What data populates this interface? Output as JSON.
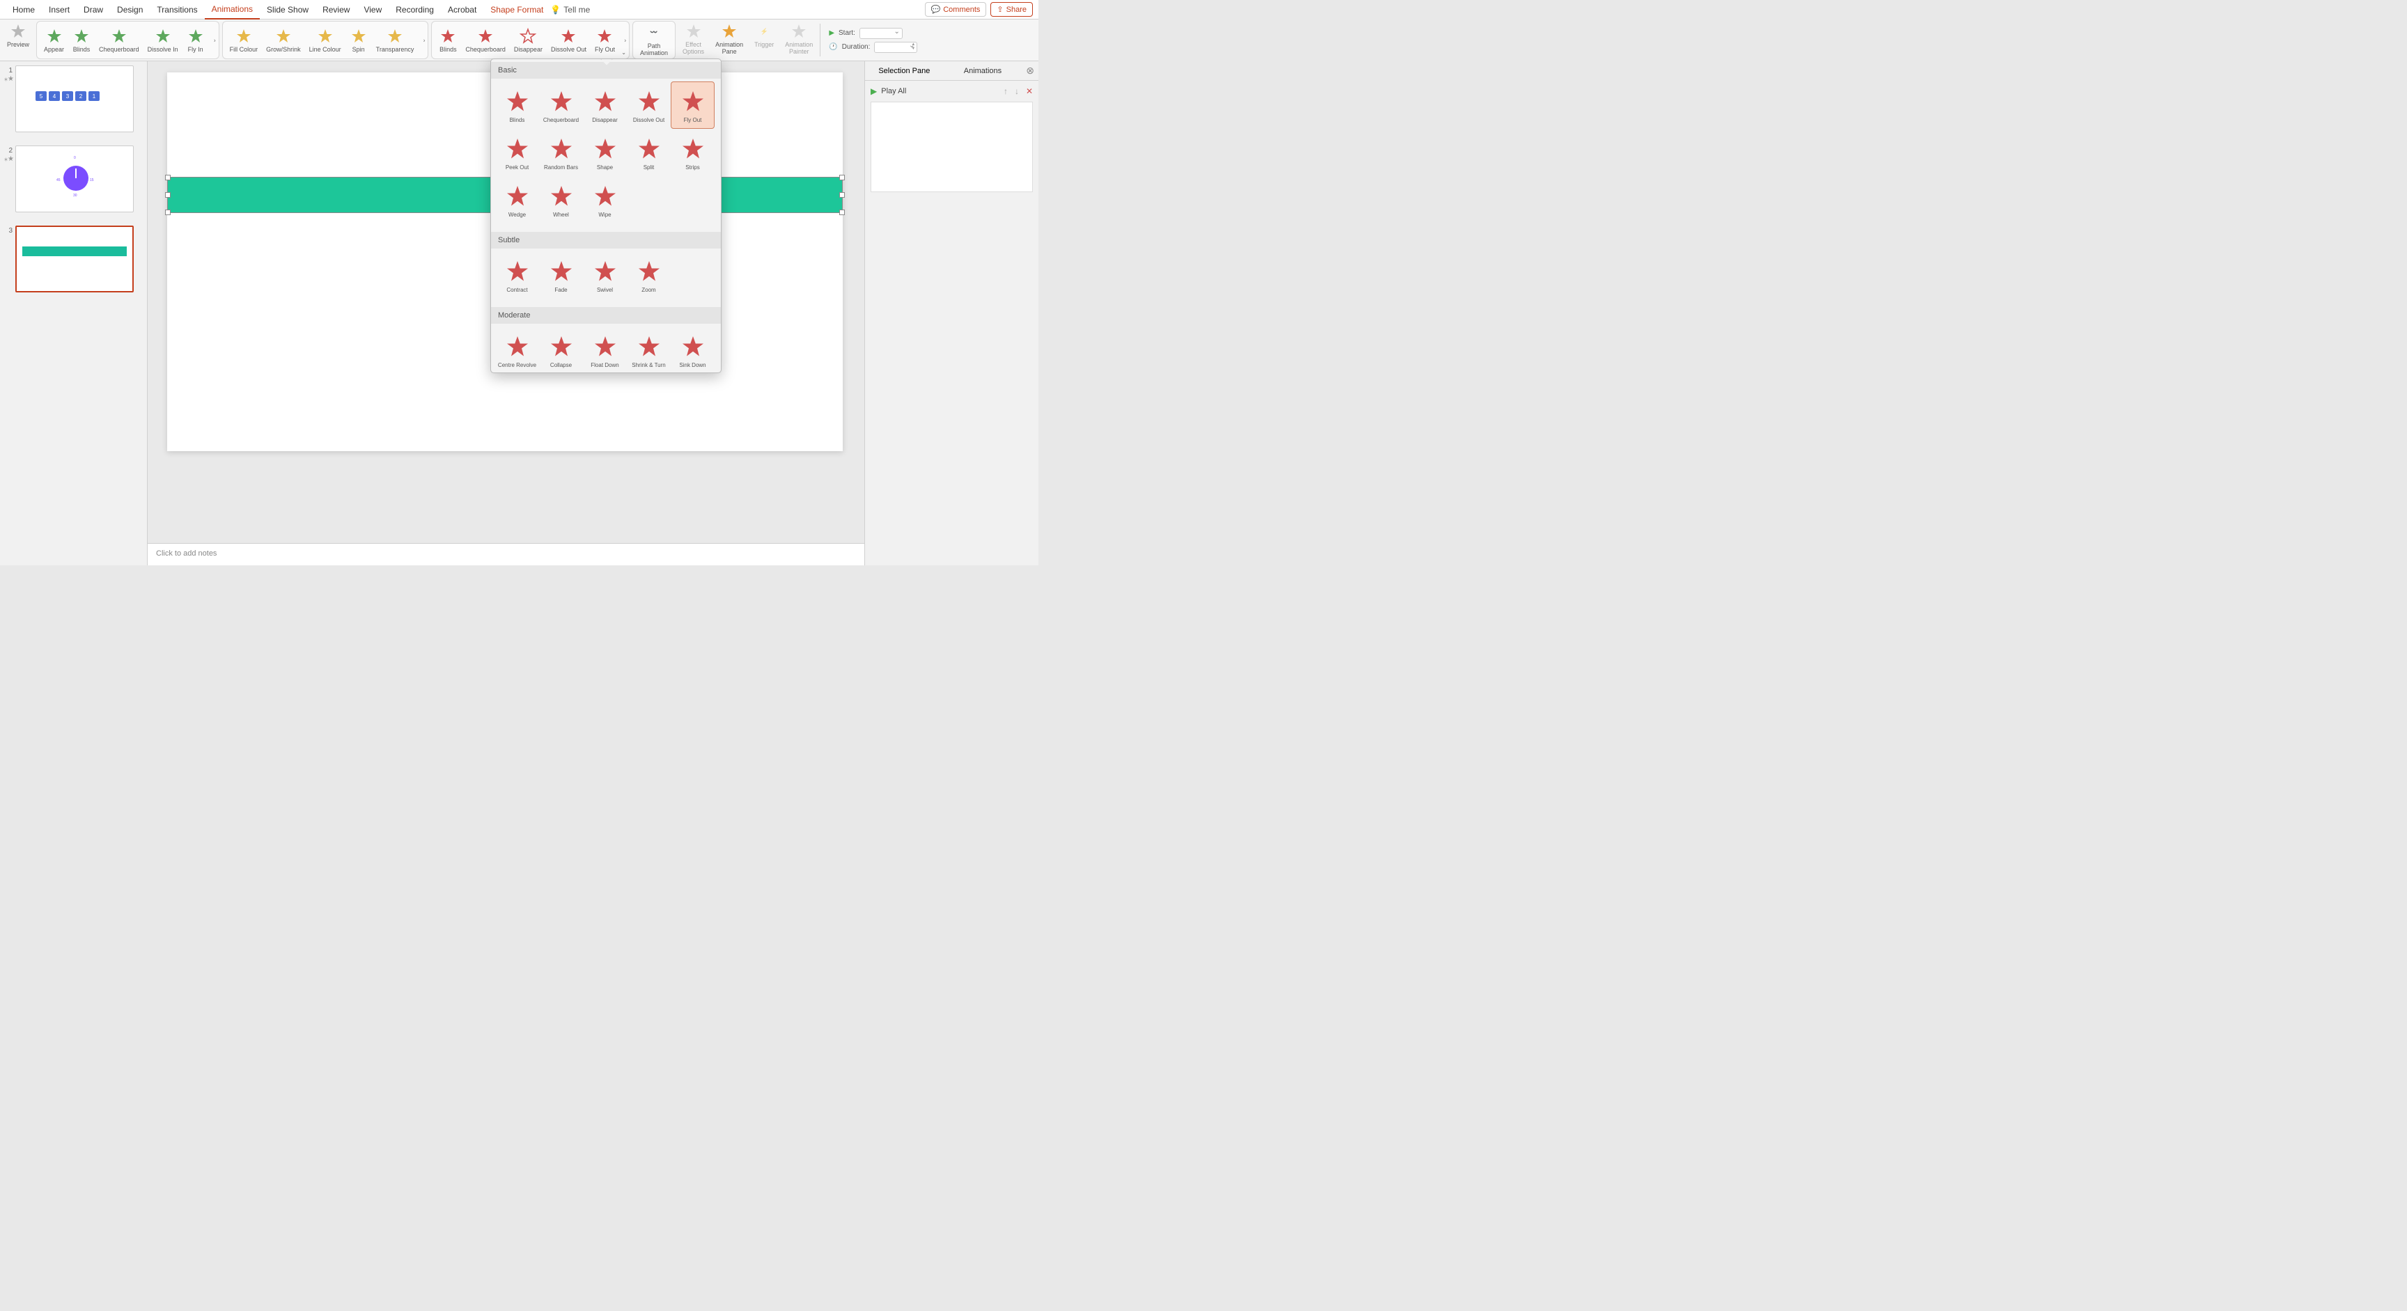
{
  "tabs": [
    "Home",
    "Insert",
    "Draw",
    "Design",
    "Transitions",
    "Animations",
    "Slide Show",
    "Review",
    "View",
    "Recording",
    "Acrobat",
    "Shape Format"
  ],
  "active_tab": "Animations",
  "context_tab": "Shape Format",
  "tellme": "Tell me",
  "comments": "Comments",
  "share": "Share",
  "ribbon": {
    "preview": "Preview",
    "entrance": [
      "Appear",
      "Blinds",
      "Chequerboard",
      "Dissolve In",
      "Fly In"
    ],
    "emphasis": [
      "Fill Colour",
      "Grow/Shrink",
      "Line Colour",
      "Spin",
      "Transparency"
    ],
    "exit": [
      "Blinds",
      "Chequerboard",
      "Disappear",
      "Dissolve Out",
      "Fly Out"
    ],
    "path_animation": "Path\nAnimation",
    "effect_options": "Effect\nOptions",
    "animation_pane": "Animation\nPane",
    "trigger": "Trigger",
    "animation_painter": "Animation\nPainter",
    "start_label": "Start:",
    "duration_label": "Duration:"
  },
  "slides": [
    {
      "num": "1",
      "boxes": [
        "5",
        "4",
        "3",
        "2",
        "1"
      ]
    },
    {
      "num": "2"
    },
    {
      "num": "3"
    }
  ],
  "notes_placeholder": "Click to add notes",
  "right_panel": {
    "tab1": "Selection Pane",
    "tab2": "Animations",
    "play_all": "Play All"
  },
  "gallery": {
    "sections": [
      {
        "header": "Basic",
        "items": [
          "Blinds",
          "Chequerboard",
          "Disappear",
          "Dissolve Out",
          "Fly Out",
          "Peek Out",
          "Random Bars",
          "Shape",
          "Split",
          "Strips",
          "Wedge",
          "Wheel",
          "Wipe"
        ],
        "selected": "Fly Out"
      },
      {
        "header": "Subtle",
        "items": [
          "Contract",
          "Fade",
          "Swivel",
          "Zoom"
        ]
      },
      {
        "header": "Moderate",
        "items": [
          "Centre Revolve",
          "Collapse",
          "Float Down",
          "Shrink & Turn",
          "Sink Down"
        ]
      }
    ]
  }
}
